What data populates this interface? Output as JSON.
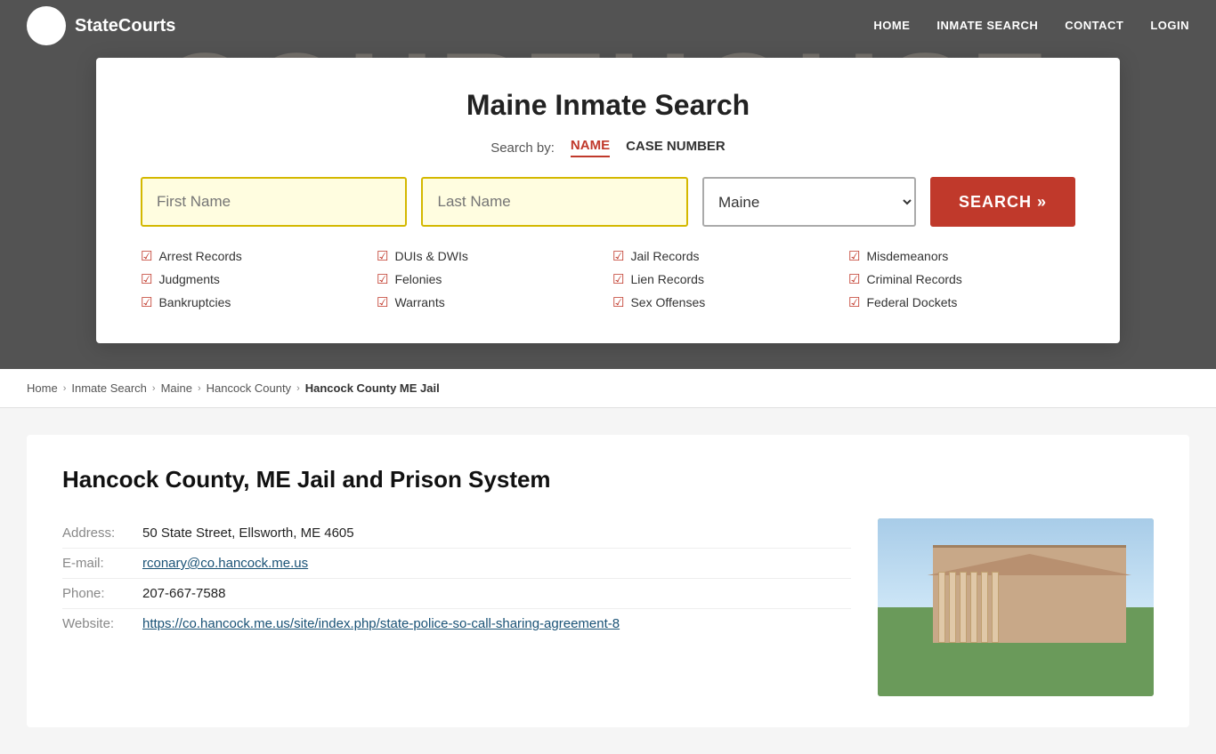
{
  "site": {
    "logo_text": "StateCourts",
    "logo_icon": "🏛"
  },
  "nav": {
    "home": "HOME",
    "inmate_search": "INMATE SEARCH",
    "contact": "CONTACT",
    "login": "LOGIN"
  },
  "hero": {
    "bg_text": "COURTHOUSE"
  },
  "modal": {
    "title": "Maine Inmate Search",
    "search_by_label": "Search by:",
    "tab_name": "NAME",
    "tab_case_number": "CASE NUMBER",
    "first_name_placeholder": "First Name",
    "last_name_placeholder": "Last Name",
    "state_value": "Maine",
    "search_button": "SEARCH »",
    "features": [
      "Arrest Records",
      "DUIs & DWIs",
      "Jail Records",
      "Misdemeanors",
      "Judgments",
      "Felonies",
      "Lien Records",
      "Criminal Records",
      "Bankruptcies",
      "Warrants",
      "Sex Offenses",
      "Federal Dockets"
    ]
  },
  "breadcrumb": {
    "items": [
      {
        "label": "Home",
        "href": "#"
      },
      {
        "label": "Inmate Search",
        "href": "#"
      },
      {
        "label": "Maine",
        "href": "#"
      },
      {
        "label": "Hancock County",
        "href": "#"
      },
      {
        "label": "Hancock County ME Jail",
        "current": true
      }
    ]
  },
  "content": {
    "title": "Hancock County, ME Jail and Prison System",
    "fields": [
      {
        "label": "Address:",
        "value": "50 State Street, Ellsworth, ME 4605",
        "type": "text"
      },
      {
        "label": "E-mail:",
        "value": "rconary@co.hancock.me.us",
        "type": "link"
      },
      {
        "label": "Phone:",
        "value": "207-667-7588",
        "type": "text"
      },
      {
        "label": "Website:",
        "value": "https://co.hancock.me.us/site/index.php/state-police-so-call-sharing-agreement-8",
        "type": "link"
      }
    ]
  }
}
